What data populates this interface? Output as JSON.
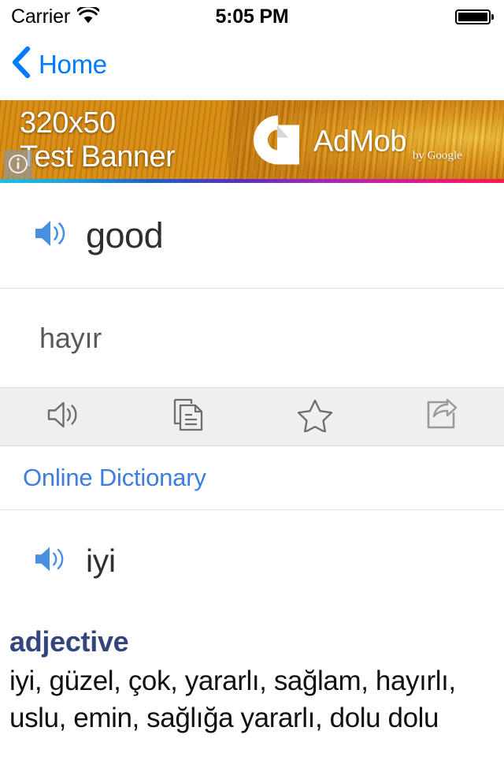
{
  "status_bar": {
    "carrier": "Carrier",
    "wifi_icon": "wifi-icon",
    "time": "5:05 PM",
    "battery_icon": "battery-full-icon"
  },
  "nav_bar": {
    "back_icon": "chevron-left-icon",
    "back_label": "Home",
    "accent_color": "#007aff"
  },
  "ad_banner": {
    "size_label": "320x50",
    "title_label": "Test Banner",
    "brand": "AdMob",
    "brand_suffix": "by Google",
    "info_badge_icon": "info-circle-icon",
    "logo_icon": "admob-logo-icon"
  },
  "entry": {
    "speaker_icon": "speaker-wave-icon",
    "headword": "good",
    "transliteration": "hayır"
  },
  "toolbar": {
    "buttons": [
      {
        "icon": "speaker-outline-icon",
        "name": "pronounce-button"
      },
      {
        "icon": "copy-pages-icon",
        "name": "copy-button"
      },
      {
        "icon": "star-outline-icon",
        "name": "favorite-button"
      },
      {
        "icon": "share-box-arrow-icon",
        "name": "share-button"
      }
    ]
  },
  "online_dictionary": {
    "label": "Online Dictionary",
    "color": "#3b7de0"
  },
  "translation": {
    "speaker_icon": "speaker-wave-icon",
    "word": "iyi"
  },
  "definition": {
    "part_of_speech": "adjective",
    "pos_color": "#33457d",
    "senses_line1": "iyi, güzel, çok, yararlı, sağlam, hayırlı,",
    "senses_line2": "uslu, emin, sağlığa yararlı, dolu dolu"
  }
}
